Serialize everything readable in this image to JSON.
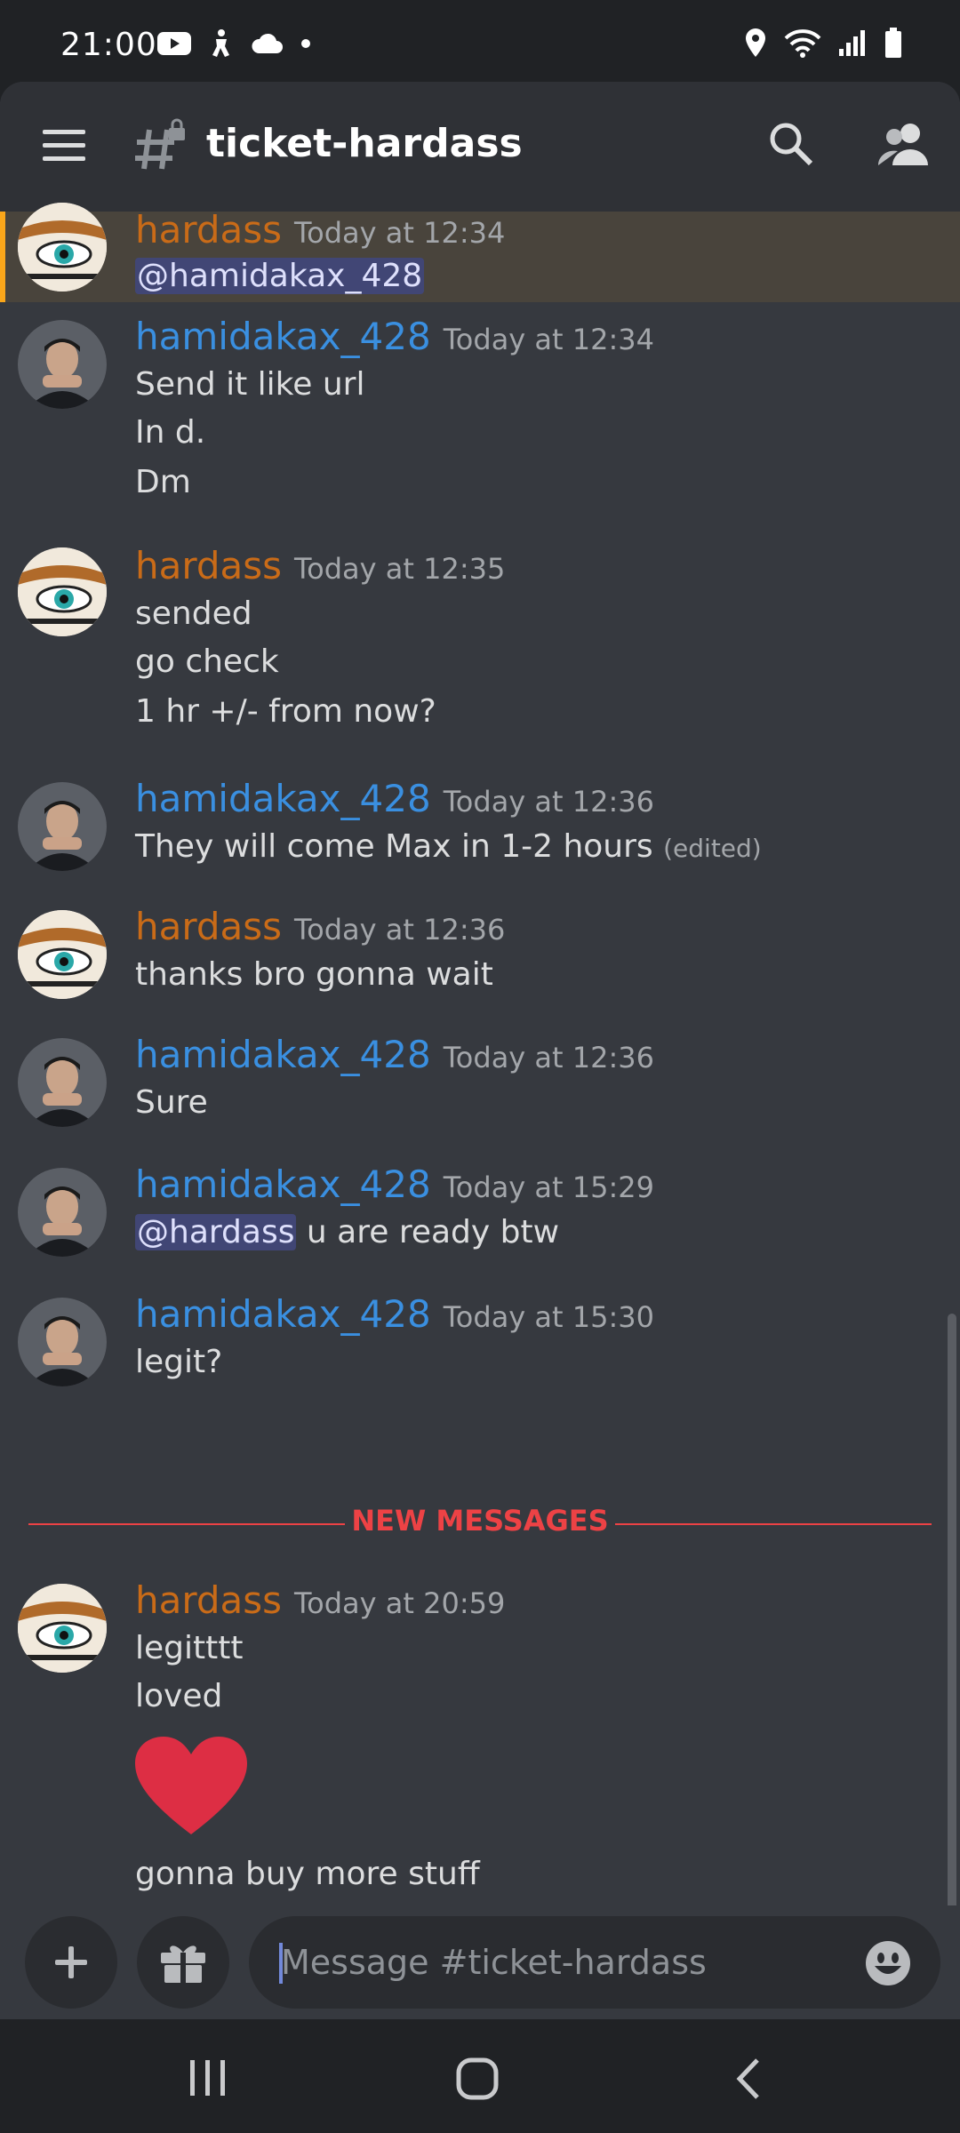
{
  "status_bar": {
    "time": "21:00"
  },
  "header": {
    "channel_name": "ticket-hardass"
  },
  "messages": [
    {
      "username": "hardass",
      "timestamp": "Today at 12:34",
      "mention": "@hamidakax_428"
    },
    {
      "username": "hamidakax_428",
      "timestamp": "Today at 12:34",
      "lines": [
        "Send it like url",
        "In d.",
        "Dm"
      ]
    },
    {
      "username": "hardass",
      "timestamp": "Today at 12:35",
      "lines": [
        "sended",
        "go check",
        "1 hr +/- from now?"
      ]
    },
    {
      "username": "hamidakax_428",
      "timestamp": "Today at 12:36",
      "text": "They will come Max in 1-2 hours",
      "edited": "(edited)"
    },
    {
      "username": "hardass",
      "timestamp": "Today at 12:36",
      "text": "thanks bro gonna wait"
    },
    {
      "username": "hamidakax_428",
      "timestamp": "Today at 12:36",
      "text": "Sure"
    },
    {
      "username": "hamidakax_428",
      "timestamp": "Today at 15:29",
      "mention": "@hardass",
      "text": " u are ready btw"
    },
    {
      "username": "hamidakax_428",
      "timestamp": "Today at 15:30",
      "text": "legit?"
    },
    {
      "username": "hardass",
      "timestamp": "Today at 20:59",
      "lines": [
        "legitttt",
        "loved",
        "gonna buy more stuff"
      ]
    }
  ],
  "divider": {
    "label": "NEW MESSAGES"
  },
  "composer": {
    "placeholder": "Message #ticket-hardass"
  },
  "colors": {
    "hardass": "#c96b18",
    "hamidakax_428": "#3a8fe0",
    "new_messages": "#ed4245",
    "highlight_bar": "#faa61a"
  }
}
